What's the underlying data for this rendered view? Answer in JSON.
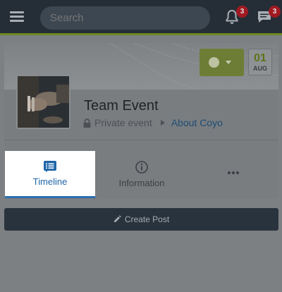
{
  "topbar": {
    "search_placeholder": "Search",
    "notifications_count": "3",
    "messages_count": "3",
    "icons": [
      "menu-icon",
      "bell-icon",
      "chat-icon"
    ],
    "accent_color": "#6e8a1f"
  },
  "event": {
    "title": "Team Event",
    "visibility": "Private event",
    "parent_page": "About Coyo",
    "date": {
      "day": "01",
      "month": "AUG"
    },
    "follow_icon": "check-circle-icon"
  },
  "tabs": [
    {
      "label": "Timeline",
      "icon": "list-icon",
      "active": true
    },
    {
      "label": "Information",
      "icon": "info-icon",
      "active": false
    },
    {
      "label": "",
      "icon": "more-icon",
      "active": false
    }
  ],
  "actions": {
    "create_post_label": "Create Post",
    "create_post_icon": "pencil-icon"
  }
}
